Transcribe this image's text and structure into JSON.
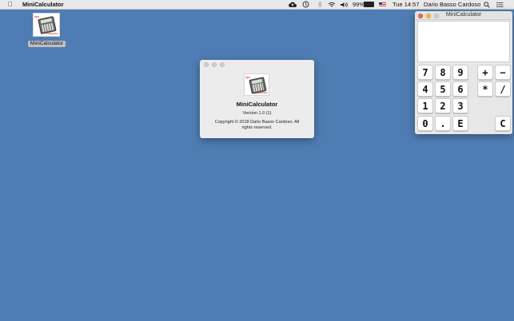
{
  "menubar": {
    "apple_icon": "apple-icon",
    "app_name": "MiniCalculator",
    "battery": "99%",
    "clock": "Tue 14:57",
    "user": "Dario Basso Cardoso"
  },
  "desktop": {
    "icon_label": "MiniCalculator",
    "background_color": "#4f7db3"
  },
  "about_window": {
    "app_name": "MiniCalculator",
    "version": "Version 1.0 (1)",
    "copyright": "Copyright © 2018 Dario Basso Cardoso. All rights reserved."
  },
  "calculator": {
    "title": "MiniCalculator",
    "display_value": "",
    "keys": {
      "k7": "7",
      "k8": "8",
      "k9": "9",
      "plus": "+",
      "minus": "−",
      "k4": "4",
      "k5": "5",
      "k6": "6",
      "times": "*",
      "divide": "/",
      "k1": "1",
      "k2": "2",
      "k3": "3",
      "k0": "0",
      "dot": ".",
      "exp": "E",
      "clear": "C"
    }
  }
}
